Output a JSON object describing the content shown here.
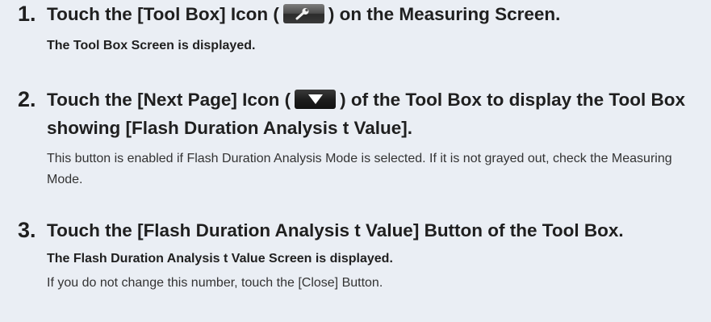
{
  "steps": [
    {
      "number": "1.",
      "text_before_icon": "Touch the [Tool Box] Icon (",
      "icon": "wrench-icon",
      "text_after_icon": ") on the Measuring Screen.",
      "result": "The Tool Box Screen is displayed."
    },
    {
      "number": "2.",
      "text_before_icon": "Touch the [Next Page] Icon (",
      "icon": "triangle-down-icon",
      "text_after_icon": ") of the Tool Box to display the Tool Box showing [Flash Duration Analysis t Value].",
      "note": "This button is enabled if Flash Duration Analysis Mode is selected. If it is not grayed out, check the Measuring Mode."
    },
    {
      "number": "3.",
      "text": "Touch the [Flash Duration Analysis t Value] Button of the Tool Box.",
      "result": "The Flash Duration Analysis t Value Screen is displayed.",
      "note": "If you do not change this number, touch the [Close] Button."
    }
  ],
  "colors": {
    "background": "#eaeef4",
    "text": "#1f1f1f",
    "note_text": "#333333"
  }
}
